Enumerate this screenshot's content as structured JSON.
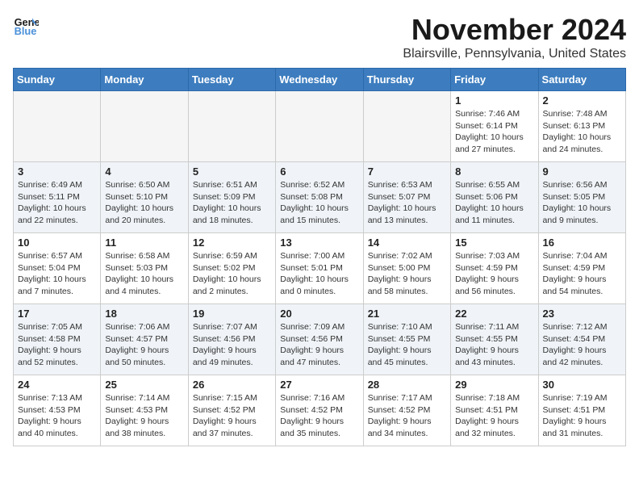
{
  "logo": {
    "line1": "General",
    "line2": "Blue"
  },
  "title": "November 2024",
  "location": "Blairsville, Pennsylvania, United States",
  "weekdays": [
    "Sunday",
    "Monday",
    "Tuesday",
    "Wednesday",
    "Thursday",
    "Friday",
    "Saturday"
  ],
  "weeks": [
    [
      {
        "day": "",
        "info": ""
      },
      {
        "day": "",
        "info": ""
      },
      {
        "day": "",
        "info": ""
      },
      {
        "day": "",
        "info": ""
      },
      {
        "day": "",
        "info": ""
      },
      {
        "day": "1",
        "info": "Sunrise: 7:46 AM\nSunset: 6:14 PM\nDaylight: 10 hours and 27 minutes."
      },
      {
        "day": "2",
        "info": "Sunrise: 7:48 AM\nSunset: 6:13 PM\nDaylight: 10 hours and 24 minutes."
      }
    ],
    [
      {
        "day": "3",
        "info": "Sunrise: 6:49 AM\nSunset: 5:11 PM\nDaylight: 10 hours and 22 minutes."
      },
      {
        "day": "4",
        "info": "Sunrise: 6:50 AM\nSunset: 5:10 PM\nDaylight: 10 hours and 20 minutes."
      },
      {
        "day": "5",
        "info": "Sunrise: 6:51 AM\nSunset: 5:09 PM\nDaylight: 10 hours and 18 minutes."
      },
      {
        "day": "6",
        "info": "Sunrise: 6:52 AM\nSunset: 5:08 PM\nDaylight: 10 hours and 15 minutes."
      },
      {
        "day": "7",
        "info": "Sunrise: 6:53 AM\nSunset: 5:07 PM\nDaylight: 10 hours and 13 minutes."
      },
      {
        "day": "8",
        "info": "Sunrise: 6:55 AM\nSunset: 5:06 PM\nDaylight: 10 hours and 11 minutes."
      },
      {
        "day": "9",
        "info": "Sunrise: 6:56 AM\nSunset: 5:05 PM\nDaylight: 10 hours and 9 minutes."
      }
    ],
    [
      {
        "day": "10",
        "info": "Sunrise: 6:57 AM\nSunset: 5:04 PM\nDaylight: 10 hours and 7 minutes."
      },
      {
        "day": "11",
        "info": "Sunrise: 6:58 AM\nSunset: 5:03 PM\nDaylight: 10 hours and 4 minutes."
      },
      {
        "day": "12",
        "info": "Sunrise: 6:59 AM\nSunset: 5:02 PM\nDaylight: 10 hours and 2 minutes."
      },
      {
        "day": "13",
        "info": "Sunrise: 7:00 AM\nSunset: 5:01 PM\nDaylight: 10 hours and 0 minutes."
      },
      {
        "day": "14",
        "info": "Sunrise: 7:02 AM\nSunset: 5:00 PM\nDaylight: 9 hours and 58 minutes."
      },
      {
        "day": "15",
        "info": "Sunrise: 7:03 AM\nSunset: 4:59 PM\nDaylight: 9 hours and 56 minutes."
      },
      {
        "day": "16",
        "info": "Sunrise: 7:04 AM\nSunset: 4:59 PM\nDaylight: 9 hours and 54 minutes."
      }
    ],
    [
      {
        "day": "17",
        "info": "Sunrise: 7:05 AM\nSunset: 4:58 PM\nDaylight: 9 hours and 52 minutes."
      },
      {
        "day": "18",
        "info": "Sunrise: 7:06 AM\nSunset: 4:57 PM\nDaylight: 9 hours and 50 minutes."
      },
      {
        "day": "19",
        "info": "Sunrise: 7:07 AM\nSunset: 4:56 PM\nDaylight: 9 hours and 49 minutes."
      },
      {
        "day": "20",
        "info": "Sunrise: 7:09 AM\nSunset: 4:56 PM\nDaylight: 9 hours and 47 minutes."
      },
      {
        "day": "21",
        "info": "Sunrise: 7:10 AM\nSunset: 4:55 PM\nDaylight: 9 hours and 45 minutes."
      },
      {
        "day": "22",
        "info": "Sunrise: 7:11 AM\nSunset: 4:55 PM\nDaylight: 9 hours and 43 minutes."
      },
      {
        "day": "23",
        "info": "Sunrise: 7:12 AM\nSunset: 4:54 PM\nDaylight: 9 hours and 42 minutes."
      }
    ],
    [
      {
        "day": "24",
        "info": "Sunrise: 7:13 AM\nSunset: 4:53 PM\nDaylight: 9 hours and 40 minutes."
      },
      {
        "day": "25",
        "info": "Sunrise: 7:14 AM\nSunset: 4:53 PM\nDaylight: 9 hours and 38 minutes."
      },
      {
        "day": "26",
        "info": "Sunrise: 7:15 AM\nSunset: 4:52 PM\nDaylight: 9 hours and 37 minutes."
      },
      {
        "day": "27",
        "info": "Sunrise: 7:16 AM\nSunset: 4:52 PM\nDaylight: 9 hours and 35 minutes."
      },
      {
        "day": "28",
        "info": "Sunrise: 7:17 AM\nSunset: 4:52 PM\nDaylight: 9 hours and 34 minutes."
      },
      {
        "day": "29",
        "info": "Sunrise: 7:18 AM\nSunset: 4:51 PM\nDaylight: 9 hours and 32 minutes."
      },
      {
        "day": "30",
        "info": "Sunrise: 7:19 AM\nSunset: 4:51 PM\nDaylight: 9 hours and 31 minutes."
      }
    ]
  ]
}
